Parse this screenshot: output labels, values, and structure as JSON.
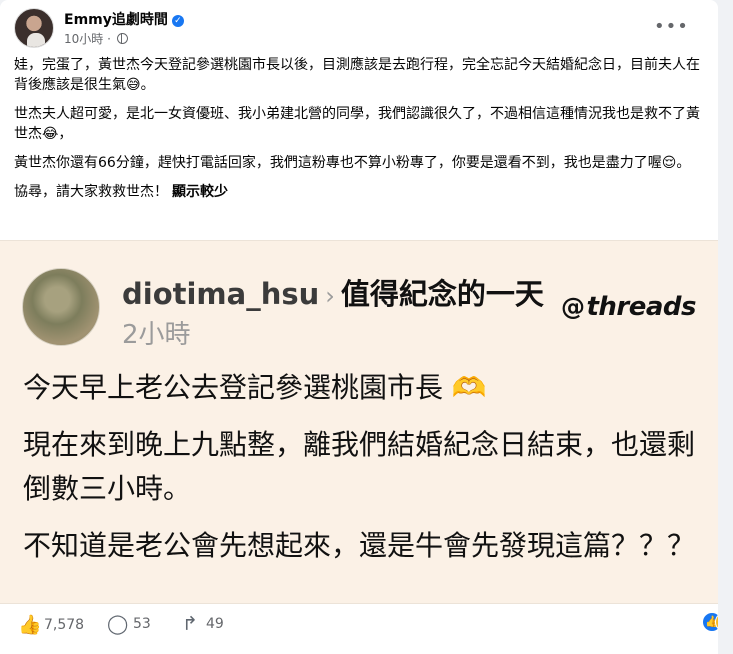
{
  "post": {
    "page_name": "Emmy追劇時間",
    "verified_glyph": "✓",
    "time": "10小時",
    "separator": "·",
    "paragraphs": [
      "娃，完蛋了，黃世杰今天登記參選桃園市長以後，目測應該是去跑行程，完全忘記今天結婚紀念日，目前夫人在背後應該是很生氣😅。",
      "世杰夫人超可愛，是北一女資優班、我小弟建北營的同學，我們認識很久了，不過相信這種情況我也是救不了黃世杰😂，",
      "黃世杰你還有66分鐘，趕快打電話回家，我們這粉專也不算小粉專了，你要是還看不到，我也是盡力了喔😌。"
    ],
    "last_paragraph": "協尋，請大家救救世杰！",
    "see_more": "顯示較少"
  },
  "threads_card": {
    "username": "diotima_hsu",
    "chevron": "›",
    "topic": "值得紀念的一天",
    "time": "2小時",
    "logo_mark": "@",
    "logo_text": "threads",
    "paragraphs": [
      "今天早上老公去登記參選桃園市長 🫶",
      "現在來到晚上九點整，離我們結婚紀念日結束，也還剩倒數三小時。",
      "不知道是老公會先想起來，還是牛會先發現這篇？？？"
    ]
  },
  "actions": {
    "like_count": "7,578",
    "comment_count": "53",
    "share_count": "49"
  },
  "icons": {
    "like": "thumbs-up-icon",
    "comment": "comment-bubble-icon",
    "share": "share-arrow-icon",
    "more": "more-dots-icon",
    "privacy": "globe-icon"
  },
  "colors": {
    "brand_blue": "#1877f2",
    "card_bg": "#fbf1e6",
    "haha_yellow": "#f7b928"
  }
}
